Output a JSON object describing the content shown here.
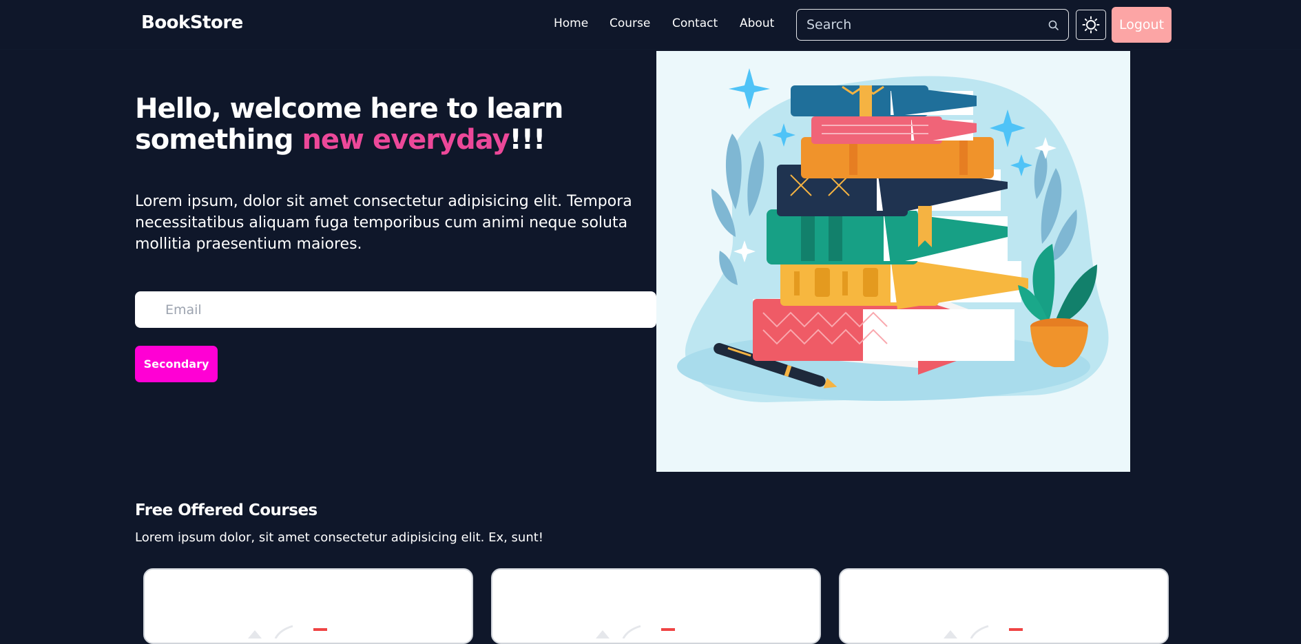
{
  "navbar": {
    "brand": "BookStore",
    "links": [
      "Home",
      "Course",
      "Contact",
      "About"
    ],
    "search_placeholder": "Search",
    "search_icon": "search-icon",
    "theme_icon": "sun-icon",
    "logout_label": "Logout"
  },
  "hero": {
    "title_line1": "Hello, welcome here to learn",
    "title_line2_prefix": "something ",
    "title_accent": "new everyday",
    "title_suffix": "!!!",
    "description": "Lorem ipsum, dolor sit amet consectetur adipisicing elit. Tempora necessitatibus aliquam fuga temporibus cum animi neque soluta mollitia praesentium maiores.",
    "email_placeholder": "Email",
    "button_label": "Secondary"
  },
  "courses_section": {
    "title": "Free Offered Courses",
    "description": "Lorem ipsum dolor, sit amet consectetur adipisicing elit. Ex, sunt!",
    "card_count_visible": 3
  },
  "colors": {
    "background": "#0f172a",
    "accent_pink": "#ec4899",
    "button_magenta": "#ff00d4",
    "logout_pink": "#fca5a5",
    "illustration_bg": "#ecf8fb"
  }
}
